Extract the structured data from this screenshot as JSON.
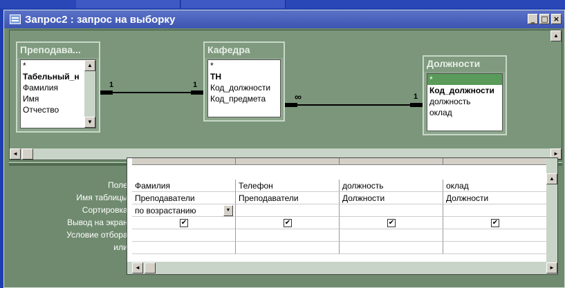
{
  "window": {
    "title": "Запрос2 : запрос на выборку",
    "buttons": {
      "minimize": "_",
      "maximize": "□",
      "close": "×"
    }
  },
  "tables": [
    {
      "title": "Преподава...",
      "fields": [
        "*",
        "Табельный_н",
        "Фамилия",
        "Имя",
        "Отчество"
      ]
    },
    {
      "title": "Кафедра",
      "fields": [
        "*",
        "ТН",
        "Код_должности",
        "Код_предмета"
      ]
    },
    {
      "title": "Должности",
      "fields": [
        "*",
        "Код_должности",
        "должность",
        "оклад"
      ]
    }
  ],
  "relations": [
    {
      "left": "1",
      "right": "1"
    },
    {
      "left": "∞",
      "right": "1"
    }
  ],
  "grid": {
    "row_labels": [
      "Поле:",
      "Имя таблицы:",
      "Сортировка:",
      "Вывод на экран:",
      "Условие отбора:",
      "или:"
    ],
    "columns": [
      {
        "field": "Фамилия",
        "table": "Преподаватели",
        "sort": "по возрастанию",
        "show": true
      },
      {
        "field": "Телефон",
        "table": "Преподаватели",
        "sort": "",
        "show": true
      },
      {
        "field": "должность",
        "table": "Должности",
        "sort": "",
        "show": true
      },
      {
        "field": "оклад",
        "table": "Должности",
        "sort": "",
        "show": true
      }
    ]
  },
  "icons": {
    "check": "✔",
    "scroll_up": "▲",
    "scroll_down": "▼",
    "scroll_left": "◄",
    "scroll_right": "►"
  }
}
